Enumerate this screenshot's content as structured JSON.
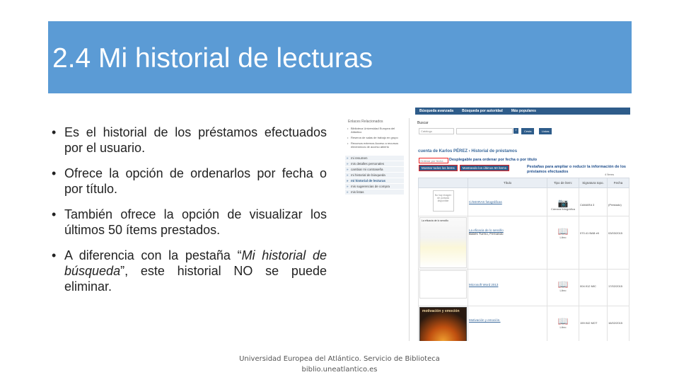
{
  "slide": {
    "title": "2.4 Mi historial de lecturas",
    "bullets": [
      {
        "text": "Es el historial de los préstamos efectuados por el usuario."
      },
      {
        "text": "Ofrece la opción de ordenarlos por fecha o por título."
      },
      {
        "text": "También ofrece la opción de visualizar los últimos 50 ítems prestados."
      },
      {
        "pre": "A diferencia con la pestaña “",
        "em": "Mi historial de búsqueda",
        "post": "”, este historial NO se puede eliminar."
      }
    ],
    "footer_line1": "Universidad Europea del Atlántico. Servicio de Biblioteca",
    "footer_line2": "biblio.uneatlantico.es"
  },
  "screenshot": {
    "topnav": [
      "Búsqueda avanzada",
      "Búsqueda por autoridad",
      "Más populares"
    ],
    "side_heading": "Enlaces Relacionados",
    "side_links": [
      "Biblioteca Universidad Europea del Atlántico",
      "Reserva de salas de trabajo en grupo",
      "Recursos externos Acceso a recursos electrónicos de acceso abierto"
    ],
    "side_menu": [
      "mi resumen",
      "mis detalles personales",
      "cambiar mi contraseña",
      "mi historial de búsqueda",
      "mi historial de lecturas",
      "mis sugerencias de compra",
      "mis listas"
    ],
    "search_label": "Buscar",
    "catalog_select": "Catálogo",
    "search_go": "»",
    "search_buttons": [
      "Cesta",
      "Listas"
    ],
    "account_title": "cuenta de Karlos PÉREZ  › Historial de préstamos",
    "sort_select": "Ordenar por fecha",
    "annotation_sort": "Desplegable para ordenar por fecha o por título",
    "tabs": [
      "Mostrar todos los ítems",
      "Mostrando los últimos 50 ítems"
    ],
    "annotation_tabs": "Pestañas para ampliar o reducir la información de los préstamos efectuados",
    "count_text": "4 Ítems",
    "columns": [
      "",
      "Título",
      "Tipo de ítem:",
      "Signatura topo.",
      "Fecha"
    ],
    "rows": [
      {
        "cover_text": "No hay imagen de portada disponible",
        "title": "CÁMARAS fotográficas",
        "author": "",
        "type": "Cámara fotográfica",
        "signature": "CAMARA 3",
        "date": "(Prestado)"
      },
      {
        "cover_text": "La eficacia de lo sencillo",
        "title": "La eficacia de lo sencillo",
        "author": "Babés Turmo, Fernando",
        "type": "Libro",
        "signature": "070.41 BAB efi",
        "date": "03/03/2015"
      },
      {
        "cover_text": "",
        "title": "Microsoft Word 2013",
        "author": "",
        "type": "Libro",
        "signature": "004.912 MIC",
        "date": "17/02/2015"
      },
      {
        "cover_text": "motivación y emoción",
        "title": "Motivación y emoción.",
        "author": "",
        "type": "Libro",
        "signature": "159.942 MOT",
        "date": "16/02/2015"
      }
    ]
  },
  "colors": {
    "title_bar": "#5b9bd5",
    "nav": "#2e5c8a",
    "link": "#3b6a9c",
    "annotation_border": "#e22222"
  },
  "icons": {
    "item_book": "book-icon",
    "item_camera": "camera-icon"
  }
}
